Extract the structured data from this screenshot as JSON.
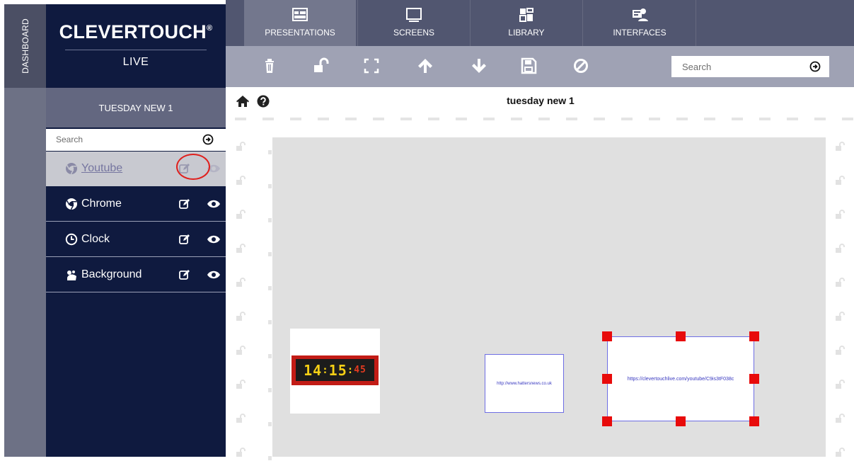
{
  "sidebar": {
    "dashboard_label": "DASHBOARD"
  },
  "brand": {
    "name": "CLEVERTOUCH",
    "mark": "®",
    "sub": "LIVE"
  },
  "panel": {
    "title": "TUESDAY NEW 1",
    "search_placeholder": "Search",
    "items": [
      {
        "label": "Youtube",
        "icon": "chrome-icon"
      },
      {
        "label": "Chrome",
        "icon": "chrome-icon"
      },
      {
        "label": "Clock",
        "icon": "clock-icon"
      },
      {
        "label": "Background",
        "icon": "paint-icon"
      }
    ]
  },
  "nav": {
    "tabs": [
      {
        "label": "PRESENTATIONS",
        "icon": "presentation-icon"
      },
      {
        "label": "SCREENS",
        "icon": "monitor-icon"
      },
      {
        "label": "LIBRARY",
        "icon": "library-icon"
      },
      {
        "label": "INTERFACES",
        "icon": "interface-icon"
      }
    ]
  },
  "toolbar": {
    "search_placeholder": "Search",
    "icons": [
      "trash-icon",
      "unlock-icon",
      "fullscreen-icon",
      "arrow-up-icon",
      "arrow-down-icon",
      "save-icon",
      "ban-icon"
    ]
  },
  "canvas": {
    "presentation_name": "tuesday new 1",
    "clock": {
      "hours": "14",
      "minutes": "15",
      "seconds": "45"
    },
    "news_url": "http://www.hattersnews.co.uk",
    "youtube_url": "https://clevertouchlive.com/youtube/C9is3tF038c"
  },
  "colors": {
    "navy": "#0f1a3f",
    "nav": "#515670",
    "toolbar": "#9fa2b4",
    "handle": "#e80b0b",
    "selected": "#c8c9d0"
  }
}
